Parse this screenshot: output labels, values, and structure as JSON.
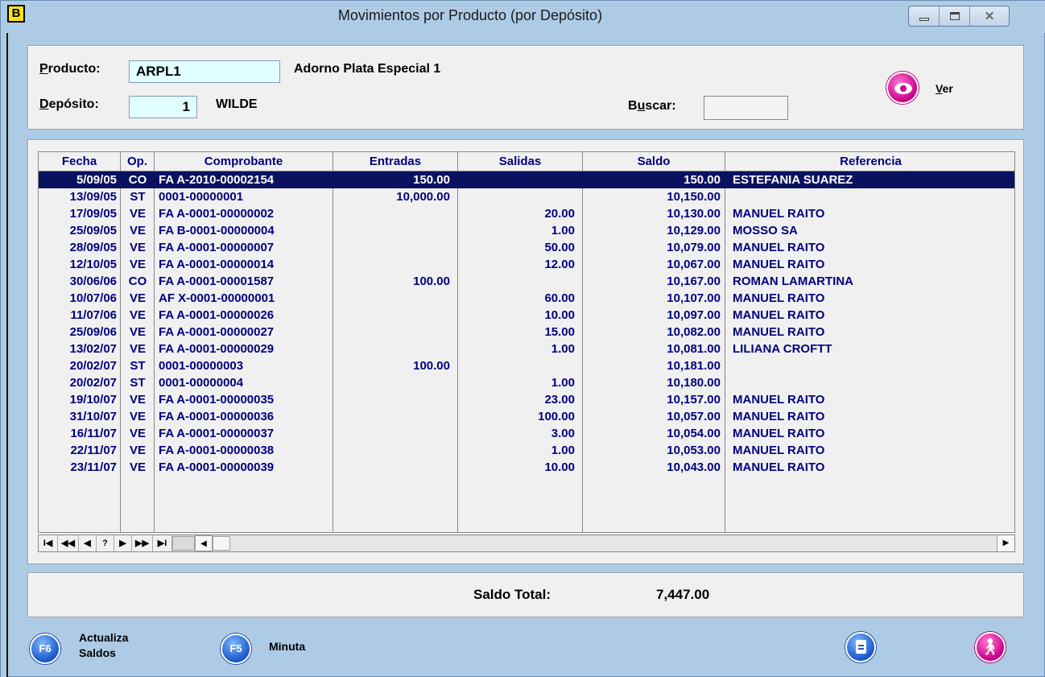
{
  "window": {
    "app_icon_letter": "B",
    "title": "Movimientos por Producto (por Depósito)",
    "close_glyph": "✕"
  },
  "form": {
    "producto_label": "Producto:",
    "producto_label_ul": "P",
    "producto_label_rest": "roducto:",
    "producto_value": "ARPL1",
    "producto_desc": "Adorno Plata Especial 1",
    "deposito_label_ul": "D",
    "deposito_label_rest": "epósito:",
    "deposito_value": "1",
    "deposito_desc": "WILDE",
    "buscar_label_pre": "B",
    "buscar_label_ul": "u",
    "buscar_label_rest": "scar:",
    "buscar_value": "",
    "ver_label_ul": "V",
    "ver_label_rest": "er"
  },
  "grid": {
    "columns": [
      "Fecha",
      "Op.",
      "Comprobante",
      "Entradas",
      "Salidas",
      "Saldo",
      "Referencia"
    ],
    "rows": [
      {
        "fecha": "5/09/05",
        "op": "CO",
        "comp": "FA A-2010-00002154",
        "entradas": "150.00",
        "salidas": "",
        "saldo": "150.00",
        "ref": "ESTEFANIA SUAREZ",
        "selected": true
      },
      {
        "fecha": "13/09/05",
        "op": "ST",
        "comp": "0001-00000001",
        "entradas": "10,000.00",
        "salidas": "",
        "saldo": "10,150.00",
        "ref": ""
      },
      {
        "fecha": "17/09/05",
        "op": "VE",
        "comp": "FA A-0001-00000002",
        "entradas": "",
        "salidas": "20.00",
        "saldo": "10,130.00",
        "ref": "MANUEL RAITO"
      },
      {
        "fecha": "25/09/05",
        "op": "VE",
        "comp": "FA B-0001-00000004",
        "entradas": "",
        "salidas": "1.00",
        "saldo": "10,129.00",
        "ref": "MOSSO SA"
      },
      {
        "fecha": "28/09/05",
        "op": "VE",
        "comp": "FA A-0001-00000007",
        "entradas": "",
        "salidas": "50.00",
        "saldo": "10,079.00",
        "ref": "MANUEL RAITO"
      },
      {
        "fecha": "12/10/05",
        "op": "VE",
        "comp": "FA A-0001-00000014",
        "entradas": "",
        "salidas": "12.00",
        "saldo": "10,067.00",
        "ref": "MANUEL RAITO"
      },
      {
        "fecha": "30/06/06",
        "op": "CO",
        "comp": "FA A-0001-00001587",
        "entradas": "100.00",
        "salidas": "",
        "saldo": "10,167.00",
        "ref": "ROMAN LAMARTINA"
      },
      {
        "fecha": "10/07/06",
        "op": "VE",
        "comp": "AF X-0001-00000001",
        "entradas": "",
        "salidas": "60.00",
        "saldo": "10,107.00",
        "ref": "MANUEL RAITO"
      },
      {
        "fecha": "11/07/06",
        "op": "VE",
        "comp": "FA A-0001-00000026",
        "entradas": "",
        "salidas": "10.00",
        "saldo": "10,097.00",
        "ref": "MANUEL RAITO"
      },
      {
        "fecha": "25/09/06",
        "op": "VE",
        "comp": "FA A-0001-00000027",
        "entradas": "",
        "salidas": "15.00",
        "saldo": "10,082.00",
        "ref": "MANUEL RAITO"
      },
      {
        "fecha": "13/02/07",
        "op": "VE",
        "comp": "FA A-0001-00000029",
        "entradas": "",
        "salidas": "1.00",
        "saldo": "10,081.00",
        "ref": "LILIANA CROFTT"
      },
      {
        "fecha": "20/02/07",
        "op": "ST",
        "comp": "0001-00000003",
        "entradas": "100.00",
        "salidas": "",
        "saldo": "10,181.00",
        "ref": ""
      },
      {
        "fecha": "20/02/07",
        "op": "ST",
        "comp": "0001-00000004",
        "entradas": "",
        "salidas": "1.00",
        "saldo": "10,180.00",
        "ref": ""
      },
      {
        "fecha": "19/10/07",
        "op": "VE",
        "comp": "FA A-0001-00000035",
        "entradas": "",
        "salidas": "23.00",
        "saldo": "10,157.00",
        "ref": "MANUEL RAITO"
      },
      {
        "fecha": "31/10/07",
        "op": "VE",
        "comp": "FA A-0001-00000036",
        "entradas": "",
        "salidas": "100.00",
        "saldo": "10,057.00",
        "ref": "MANUEL RAITO"
      },
      {
        "fecha": "16/11/07",
        "op": "VE",
        "comp": "FA A-0001-00000037",
        "entradas": "",
        "salidas": "3.00",
        "saldo": "10,054.00",
        "ref": "MANUEL RAITO"
      },
      {
        "fecha": "22/11/07",
        "op": "VE",
        "comp": "FA A-0001-00000038",
        "entradas": "",
        "salidas": "1.00",
        "saldo": "10,053.00",
        "ref": "MANUEL RAITO"
      },
      {
        "fecha": "23/11/07",
        "op": "VE",
        "comp": "FA A-0001-00000039",
        "entradas": "",
        "salidas": "10.00",
        "saldo": "10,043.00",
        "ref": "MANUEL RAITO"
      }
    ]
  },
  "navigator": {
    "first": "I◀",
    "prev_page": "◀◀",
    "prev": "◀",
    "search": "?",
    "next": "▶",
    "next_page": "▶▶",
    "last": "▶I",
    "scroll_left": "◀",
    "scroll_right": "▶"
  },
  "totals": {
    "label": "Saldo Total:",
    "value": "7,447.00"
  },
  "footer": {
    "f6_key": "F6",
    "f6_label_line1": "Actualiza",
    "f6_label_line2": "Saldos",
    "f5_key": "F5",
    "f5_label": "Minuta"
  },
  "colors": {
    "window_bg": "#aecbe6",
    "field_bg": "#e0ffff",
    "grid_text": "#000080",
    "selected_row": "#0a1260",
    "ver_button": "#c8008a",
    "f_buttons": "#1a58c8"
  },
  "icons": [
    "app-icon",
    "minimize-icon",
    "maximize-icon",
    "close-icon",
    "eye-icon",
    "document-icon",
    "exit-walking-icon"
  ]
}
